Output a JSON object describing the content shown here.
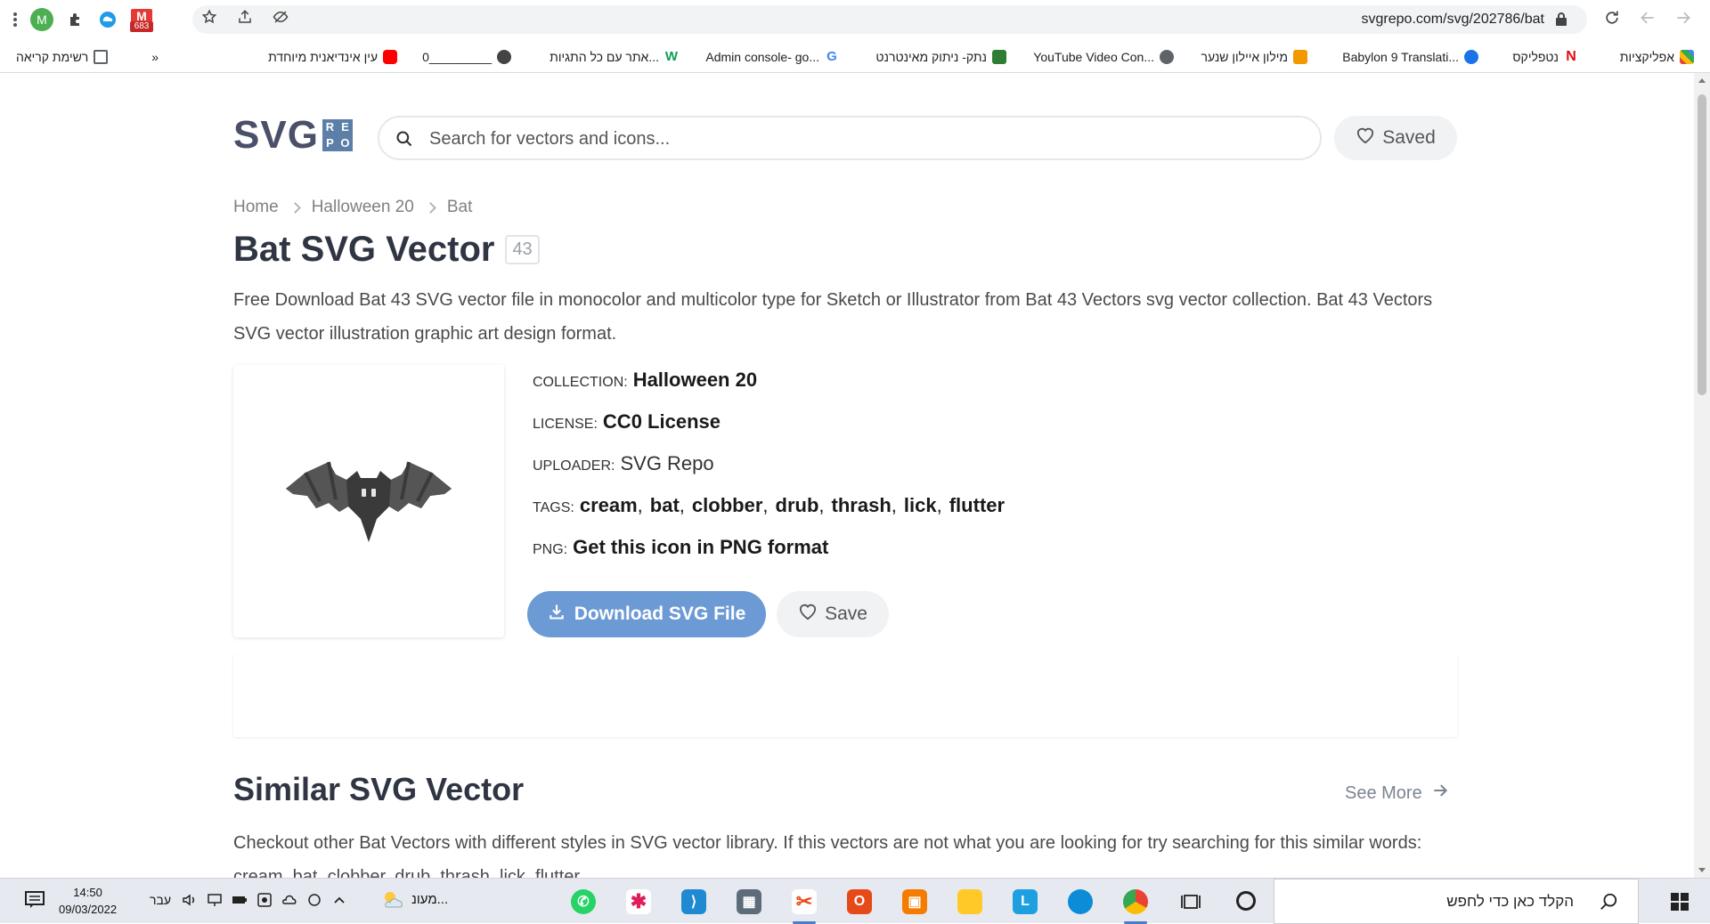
{
  "browser": {
    "profile_initial": "M",
    "gmail_count": "683",
    "url": "svgrepo.com/svg/202786/bat",
    "bookmarks": [
      {
        "label": "אפליקציות",
        "color": "#e8453c"
      },
      {
        "label": "נטפליקס",
        "color": "#e50914"
      },
      {
        "label": "Babylon 9 Translati...",
        "color": "#1a73e8"
      },
      {
        "label": "מילון איילון שנער",
        "color": "#f29900"
      },
      {
        "label": "YouTube Video Con...",
        "color": "#5f6368"
      },
      {
        "label": "נתק- ניתוק מאינטרנט",
        "color": "#2e7d32"
      },
      {
        "label": "Admin console- go...",
        "color": "#4285f4"
      },
      {
        "label": "אתר עם כל התגיות...",
        "color": "#0f9d58"
      },
      {
        "label": "0_________",
        "color": "#444444"
      },
      {
        "label": "עין אינדיאנית מיוחדת",
        "color": "#ff0000"
      },
      {
        "label": "»",
        "color": ""
      },
      {
        "label": "רשימת קריאה",
        "color": "#5f6368"
      }
    ]
  },
  "header": {
    "logo_main": "SVG",
    "logo_grid": [
      "R",
      "E",
      "P",
      "O"
    ],
    "search_placeholder": "Search for vectors and icons...",
    "saved_label": "Saved"
  },
  "breadcrumb": [
    "Home",
    "Halloween 20",
    "Bat"
  ],
  "title": "Bat SVG Vector",
  "title_badge": "43",
  "description": "Free Download Bat 43 SVG vector file in monocolor and multicolor type for Sketch or Illustrator from Bat 43 Vectors svg vector collection. Bat 43 Vectors SVG vector illustration graphic art design format.",
  "meta": {
    "collection_key": "COLLECTION:",
    "collection_val": "Halloween 20",
    "license_key": "LICENSE:",
    "license_val": "CC0 License",
    "uploader_key": "UPLOADER:",
    "uploader_val": "SVG Repo",
    "tags_key": "TAGS:",
    "tags": [
      "cream",
      "bat",
      "clobber",
      "drub",
      "thrash",
      "lick",
      "flutter"
    ],
    "png_key": "PNG:",
    "png_val": "Get this icon in PNG format"
  },
  "actions": {
    "download_label": "Download SVG File",
    "save_label": "Save"
  },
  "similar": {
    "title": "Similar SVG Vector",
    "see_more": "See More",
    "description": "Checkout other Bat Vectors with different styles in SVG vector library. If this vectors are not what you are looking for try searching for this similar words: cream, bat, clobber, drub, thrash, lick, flutter"
  },
  "taskbar": {
    "time": "14:50",
    "date": "09/03/2022",
    "lang": "עבר",
    "weather": "מעונ...",
    "search_text": "הקלד כאן כדי לחפש"
  },
  "colors": {
    "accent_blue": "#6c9ad4",
    "logo_dark": "#4a4f6a",
    "logo_blue": "#5c7fa8",
    "bat_body": "#3a3a3a",
    "bat_wing": "#555555"
  }
}
